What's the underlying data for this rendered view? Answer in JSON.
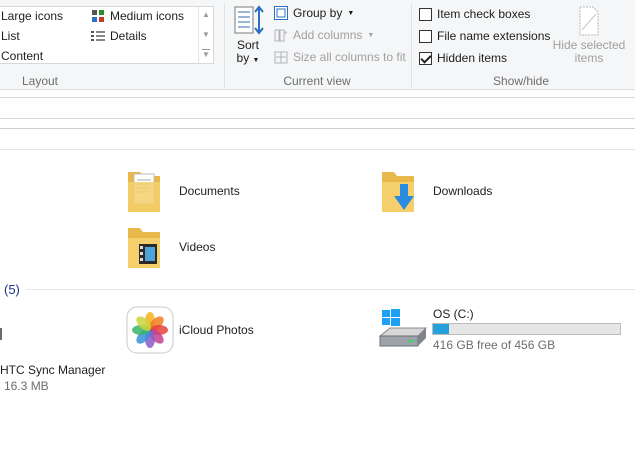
{
  "ribbon": {
    "layout": {
      "group_label": "Layout",
      "items": {
        "large_icons": "Large icons",
        "medium_icons": "Medium icons",
        "list": "List",
        "details": "Details",
        "content": "Content"
      }
    },
    "current_view": {
      "group_label": "Current view",
      "sort_by_line1": "Sort",
      "sort_by_line2": "by",
      "group_by": "Group by",
      "add_columns": "Add columns",
      "size_all_columns": "Size all columns to fit"
    },
    "show_hide": {
      "group_label": "Show/hide",
      "item_check_boxes": "Item check boxes",
      "file_name_extensions": "File name extensions",
      "hidden_items": "Hidden items",
      "hide_selected_line1": "Hide selected",
      "hide_selected_line2": "items",
      "checked": {
        "item_check_boxes": false,
        "file_name_extensions": false,
        "hidden_items": true
      }
    }
  },
  "folders": [
    {
      "name": "Documents",
      "icon": "documents-folder-icon"
    },
    {
      "name": "Downloads",
      "icon": "downloads-folder-icon"
    },
    {
      "name": "Videos",
      "icon": "videos-folder-icon"
    }
  ],
  "devices_section": {
    "header": "(5)",
    "items": {
      "htc": {
        "name": "HTC Sync Manager",
        "size": "16.3 MB"
      },
      "icloud": {
        "name": "iCloud Photos"
      },
      "drive": {
        "name": "OS (C:)",
        "free": "416 GB free of 456 GB",
        "used_fraction": 0.088
      }
    }
  },
  "colors": {
    "accent": "#26a0da",
    "section_header": "#1e3287",
    "folder": "#f4cf6b"
  }
}
